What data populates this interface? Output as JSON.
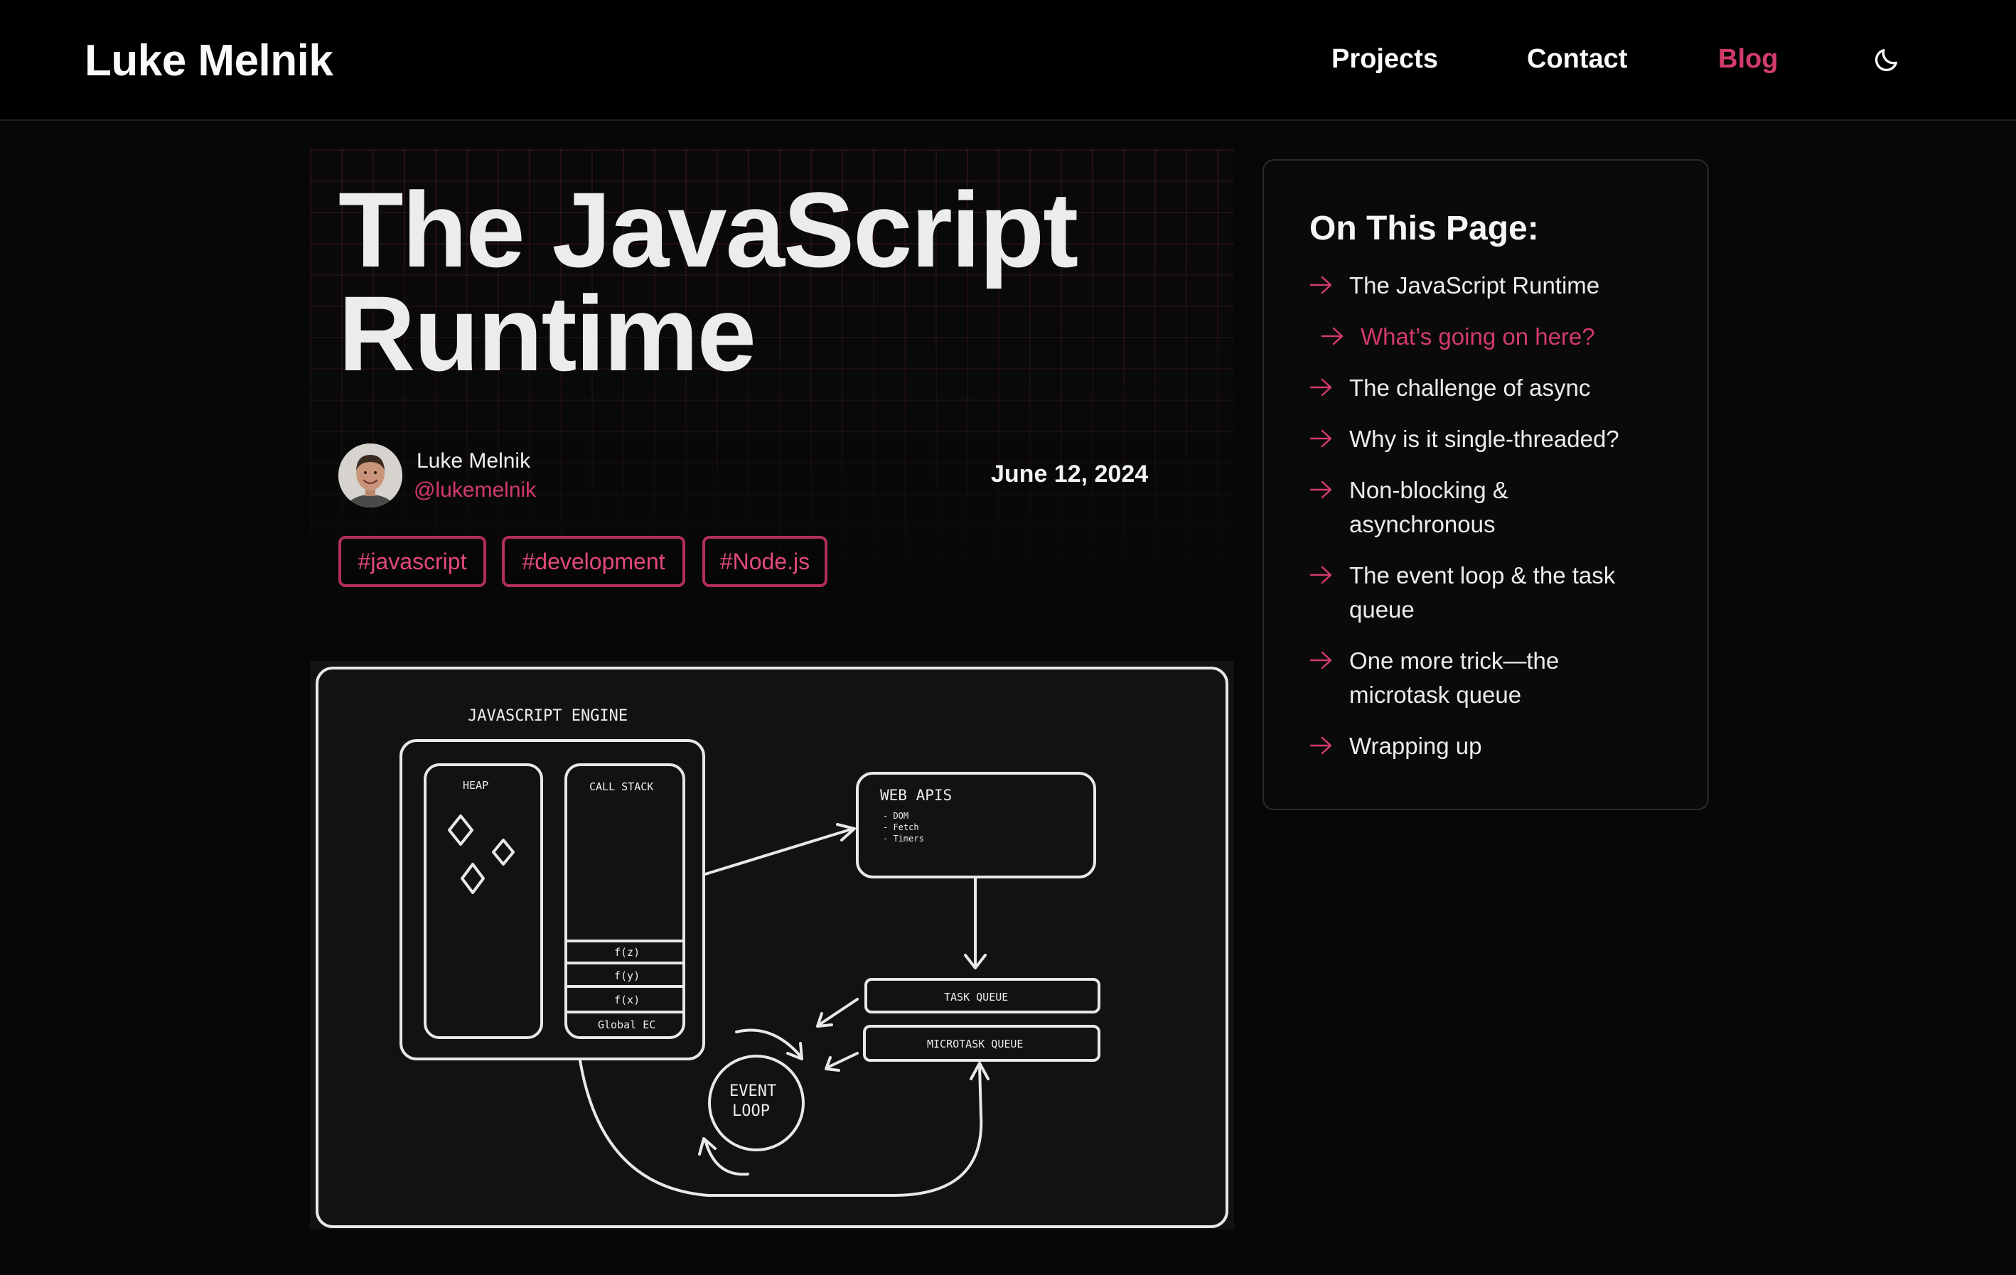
{
  "header": {
    "logo": "Luke Melnik",
    "nav": {
      "projects": "Projects",
      "contact": "Contact",
      "blog": "Blog"
    },
    "theme_toggle_icon": "moon-icon"
  },
  "post": {
    "title_line1": "The JavaScript",
    "title_line2": "Runtime",
    "author": {
      "name": "Luke Melnik",
      "handle": "@lukemelnik"
    },
    "date": "June 12, 2024",
    "tags": [
      "#javascript",
      "#development",
      "#Node.js"
    ]
  },
  "diagram": {
    "engine_label": "JAVASCRIPT ENGINE",
    "heap_label": "HEAP",
    "call_stack_label": "CALL STACK",
    "stack_frames": [
      "f(z)",
      "f(y)",
      "f(x)",
      "Global EC"
    ],
    "web_apis_label": "WEB APIS",
    "web_apis_items": [
      "- DOM",
      "- Fetch",
      "- Timers"
    ],
    "task_queue_label": "TASK QUEUE",
    "microtask_queue_label": "MICROTASK QUEUE",
    "event_loop_line1": "EVENT",
    "event_loop_line2": "LOOP"
  },
  "toc": {
    "title": "On This Page:",
    "items": [
      {
        "label": "The JavaScript Runtime"
      },
      {
        "label": "What’s going on here?",
        "active": true
      },
      {
        "label": "The challenge of async"
      },
      {
        "label": "Why is it single-threaded?"
      },
      {
        "label": "Non-blocking & asynchronous"
      },
      {
        "label": "The event loop & the task queue"
      },
      {
        "label": "One more trick—the microtask queue"
      },
      {
        "label": "Wrapping up"
      }
    ]
  },
  "colors": {
    "accent": "#d23b6a",
    "background": "#070707",
    "text": "#ececec"
  }
}
